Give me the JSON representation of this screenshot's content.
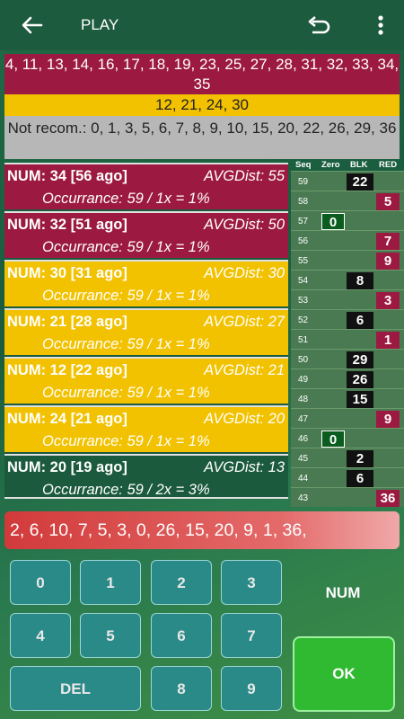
{
  "header": {
    "title": "PLAY",
    "back_icon": "arrow-left-icon",
    "undo_icon": "undo-icon",
    "more_icon": "more-vert-icon"
  },
  "recommendations": {
    "red_numbers": "4, 11, 13, 14, 16, 17, 18, 19, 23, 25, 27, 28, 31, 32, 33, 34, 35",
    "yellow_numbers": "12, 21, 24, 30",
    "not_recommended": "Not recom.: 0, 1, 3, 5, 6, 7, 8, 9, 10, 15, 20, 22, 26, 29, 36"
  },
  "cards": [
    {
      "num": "NUM: 34 [56 ago]",
      "avg": "AVGDist: 55",
      "occ": "Occurrance: 59 / 1x = 1%",
      "color": "red"
    },
    {
      "num": "NUM: 32 [51 ago]",
      "avg": "AVGDist: 50",
      "occ": "Occurrance: 59 / 1x = 1%",
      "color": "red"
    },
    {
      "num": "NUM: 30 [31 ago]",
      "avg": "AVGDist: 30",
      "occ": "Occurrance: 59 / 1x = 1%",
      "color": "yellow"
    },
    {
      "num": "NUM: 21 [28 ago]",
      "avg": "AVGDist: 27",
      "occ": "Occurrance: 59 / 1x = 1%",
      "color": "yellow"
    },
    {
      "num": "NUM: 12 [22 ago]",
      "avg": "AVGDist: 21",
      "occ": "Occurrance: 59 / 1x = 1%",
      "color": "yellow"
    },
    {
      "num": "NUM: 24 [21 ago]",
      "avg": "AVGDist: 20",
      "occ": "Occurrance: 59 / 1x = 1%",
      "color": "yellow"
    },
    {
      "num": "NUM: 20 [19 ago]",
      "avg": "AVGDist: 13",
      "occ": "Occurrance: 59 / 2x = 3%",
      "color": "green"
    },
    {
      "num": "-",
      "avg": "",
      "occ": "",
      "color": "green"
    }
  ],
  "history_table": {
    "headers": [
      "Seq",
      "Zero",
      "BLK",
      "RED"
    ],
    "rows": [
      {
        "seq": "59",
        "zero": "",
        "blk": "22",
        "red": ""
      },
      {
        "seq": "58",
        "zero": "",
        "blk": "",
        "red": "5"
      },
      {
        "seq": "57",
        "zero": "0",
        "blk": "",
        "red": ""
      },
      {
        "seq": "56",
        "zero": "",
        "blk": "",
        "red": "7"
      },
      {
        "seq": "55",
        "zero": "",
        "blk": "",
        "red": "9"
      },
      {
        "seq": "54",
        "zero": "",
        "blk": "8",
        "red": ""
      },
      {
        "seq": "53",
        "zero": "",
        "blk": "",
        "red": "3"
      },
      {
        "seq": "52",
        "zero": "",
        "blk": "6",
        "red": ""
      },
      {
        "seq": "51",
        "zero": "",
        "blk": "",
        "red": "1"
      },
      {
        "seq": "50",
        "zero": "",
        "blk": "29",
        "red": ""
      },
      {
        "seq": "49",
        "zero": "",
        "blk": "26",
        "red": ""
      },
      {
        "seq": "48",
        "zero": "",
        "blk": "15",
        "red": ""
      },
      {
        "seq": "47",
        "zero": "",
        "blk": "",
        "red": "9"
      },
      {
        "seq": "46",
        "zero": "0",
        "blk": "",
        "red": ""
      },
      {
        "seq": "45",
        "zero": "",
        "blk": "2",
        "red": ""
      },
      {
        "seq": "44",
        "zero": "",
        "blk": "6",
        "red": ""
      },
      {
        "seq": "43",
        "zero": "",
        "blk": "",
        "red": "36"
      }
    ]
  },
  "history_strip": "2, 6, 10, 7, 5, 3, 0, 26, 15, 20, 9, 1, 36,",
  "keypad": {
    "keys": [
      "0",
      "1",
      "2",
      "3",
      "4",
      "5",
      "6",
      "7",
      "DEL",
      "8",
      "9"
    ],
    "num_label": "NUM",
    "ok_label": "OK"
  }
}
